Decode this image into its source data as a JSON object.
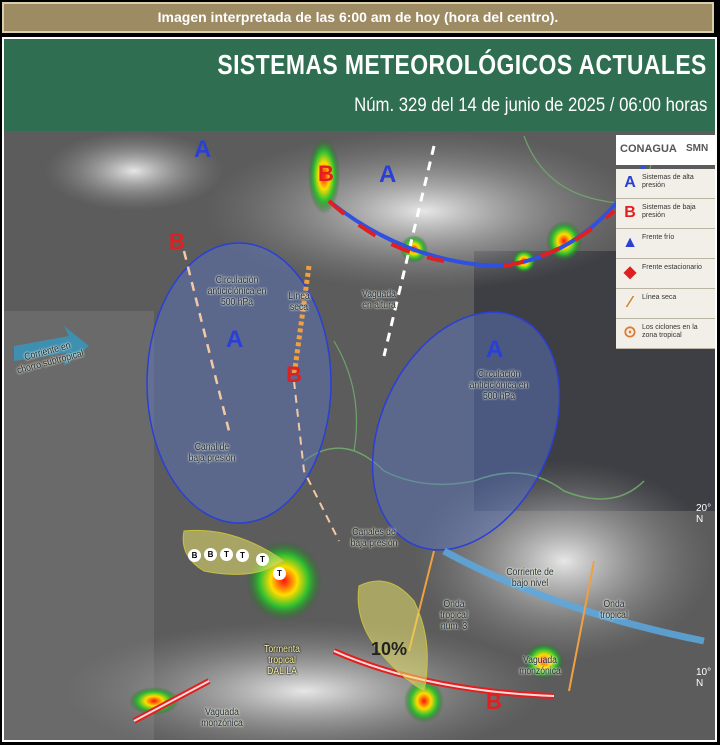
{
  "banner": "Imagen interpretada de las 6:00 am de hoy (hora del centro).",
  "header": {
    "title": "SISTEMAS METEOROLÓGICOS ACTUALES",
    "subtitle": "Núm. 329 del 14 de junio de 2025 / 06:00 horas"
  },
  "logos": {
    "conagua": "CONAGUA",
    "smn": "SMN"
  },
  "legend": [
    {
      "symbol": "A",
      "text": "Sistemas de alta presión",
      "color": "#2a3fd6"
    },
    {
      "symbol": "B",
      "text": "Sistemas de baja presión",
      "color": "#e02020"
    },
    {
      "symbol": "▲",
      "text": "Frente frío",
      "color": "#2a3fd6"
    },
    {
      "symbol": "◆",
      "text": "Frente estacionario",
      "color": "#e02020"
    },
    {
      "symbol": "⁄",
      "text": "Línea seca",
      "color": "#d07a20"
    },
    {
      "symbol": "⊙",
      "text": "Los ciclones en la zona tropical",
      "color": "#e07a30"
    }
  ],
  "labels": {
    "circ1": "Circulación anticiclónica en 500 hPa",
    "linea_seca": "Línea seca",
    "vaguada_altura": "Vaguada en altura",
    "circ2": "Circulación anticiclónica en 500 hPa",
    "canal": "Canal de baja presión",
    "corriente_chorro": "Corriente en chorro subtropical",
    "canales": "Canales de baja presión",
    "corriente_bajo": "Corriente de bajo nivel",
    "onda3": "Onda tropical núm. 3",
    "onda": "Onda tropical",
    "tormenta": "Tormenta tropical DALILA",
    "vaguada_mon1": "Vaguada monzónica",
    "vaguada_mon2": "Vaguada monzónica",
    "pct": "10%",
    "lat20": "20° N",
    "lat10": "10° N"
  },
  "pressure": {
    "high": "A",
    "low": "B"
  },
  "cyclone_track": [
    "B",
    "B",
    "T",
    "T",
    "T",
    "T"
  ],
  "colors": {
    "header": "#2f6e50",
    "banner": "#9c8b63"
  }
}
